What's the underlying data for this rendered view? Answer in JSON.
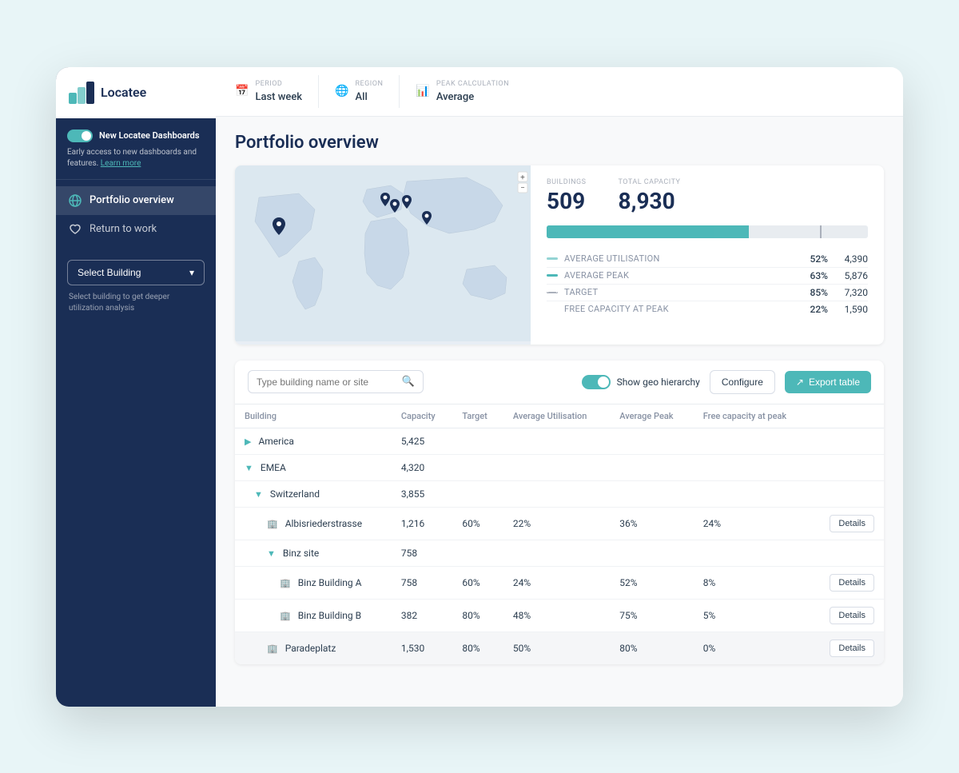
{
  "app": {
    "logo_text": "Locatee"
  },
  "sidebar": {
    "promo": {
      "toggle_label": "New Locatee Dashboards",
      "description": "Early access to new dashboards and features.",
      "link_text": "Learn more"
    },
    "nav_items": [
      {
        "id": "portfolio",
        "label": "Portfolio overview",
        "icon": "globe"
      },
      {
        "id": "return",
        "label": "Return to work",
        "icon": "heart"
      }
    ],
    "select_building": {
      "label": "Select Building",
      "hint": "Select building to get deeper utilization analysis"
    }
  },
  "filters": {
    "period": {
      "label": "PERIOD",
      "value": "Last week"
    },
    "region": {
      "label": "REGION",
      "value": "All"
    },
    "peak_calc": {
      "label": "PEAK CALCULATION",
      "value": "Average"
    }
  },
  "page": {
    "title": "Portfolio overview"
  },
  "overview": {
    "buildings_label": "BUILDINGS",
    "buildings_value": "509",
    "total_capacity_label": "TOTAL CAPACITY",
    "total_capacity_value": "8,930",
    "metrics": [
      {
        "id": "avg_util",
        "name": "AVERAGE UTILISATION",
        "pct": "52%",
        "val": "4,390",
        "color": "#4db8b8",
        "opacity": "0.6"
      },
      {
        "id": "avg_peak",
        "name": "AVERAGE PEAK",
        "pct": "63%",
        "val": "5,876",
        "color": "#4db8b8",
        "opacity": "1"
      },
      {
        "id": "target",
        "name": "TARGET",
        "pct": "85%",
        "val": "7,320",
        "color": "dashed",
        "opacity": "1"
      },
      {
        "id": "free_cap",
        "name": "FREE CAPACITY AT PEAK",
        "pct": "22%",
        "val": "1,590",
        "color": "none",
        "opacity": "1"
      }
    ]
  },
  "table": {
    "search_placeholder": "Type building name or site",
    "geo_hierarchy_label": "Show geo hierarchy",
    "configure_label": "Configure",
    "export_label": "Export table",
    "columns": [
      "Building",
      "Capacity",
      "Target",
      "Average Utilisation",
      "Average Peak",
      "Free capacity at peak",
      ""
    ],
    "rows": [
      {
        "id": "america",
        "indent": 0,
        "expand": true,
        "expanded": false,
        "icon": "none",
        "name": "America",
        "capacity": "5,425",
        "target": "",
        "avg_util": "",
        "avg_peak": "",
        "free_cap": "",
        "details": false
      },
      {
        "id": "emea",
        "indent": 0,
        "expand": true,
        "expanded": true,
        "icon": "none",
        "name": "EMEA",
        "capacity": "4,320",
        "target": "",
        "avg_util": "",
        "avg_peak": "",
        "free_cap": "",
        "details": false
      },
      {
        "id": "switzerland",
        "indent": 1,
        "expand": true,
        "expanded": true,
        "icon": "none",
        "name": "Switzerland",
        "capacity": "3,855",
        "target": "",
        "avg_util": "",
        "avg_peak": "",
        "free_cap": "",
        "details": false
      },
      {
        "id": "albisrieder",
        "indent": 2,
        "expand": false,
        "expanded": false,
        "icon": "building",
        "name": "Albisriederstrasse",
        "capacity": "1,216",
        "target": "60%",
        "avg_util": "22%",
        "avg_peak": "36%",
        "free_cap": "24%",
        "details": true
      },
      {
        "id": "binz_site",
        "indent": 2,
        "expand": true,
        "expanded": true,
        "icon": "none",
        "name": "Binz site",
        "capacity": "758",
        "target": "",
        "avg_util": "",
        "avg_peak": "",
        "free_cap": "",
        "details": false
      },
      {
        "id": "binz_a",
        "indent": 3,
        "expand": false,
        "expanded": false,
        "icon": "building",
        "name": "Binz Building A",
        "capacity": "758",
        "target": "60%",
        "avg_util": "24%",
        "avg_peak": "52%",
        "free_cap": "8%",
        "details": true
      },
      {
        "id": "binz_b",
        "indent": 3,
        "expand": false,
        "expanded": false,
        "icon": "building",
        "name": "Binz Building B",
        "capacity": "382",
        "target": "80%",
        "avg_util": "48%",
        "avg_peak": "75%",
        "free_cap": "5%",
        "details": true
      },
      {
        "id": "paradeplatz",
        "indent": 2,
        "expand": false,
        "expanded": false,
        "icon": "building",
        "name": "Paradeplatz",
        "capacity": "1,530",
        "target": "80%",
        "avg_util": "50%",
        "avg_peak": "80%",
        "free_cap": "0%",
        "details": true,
        "highlighted": true
      }
    ]
  }
}
